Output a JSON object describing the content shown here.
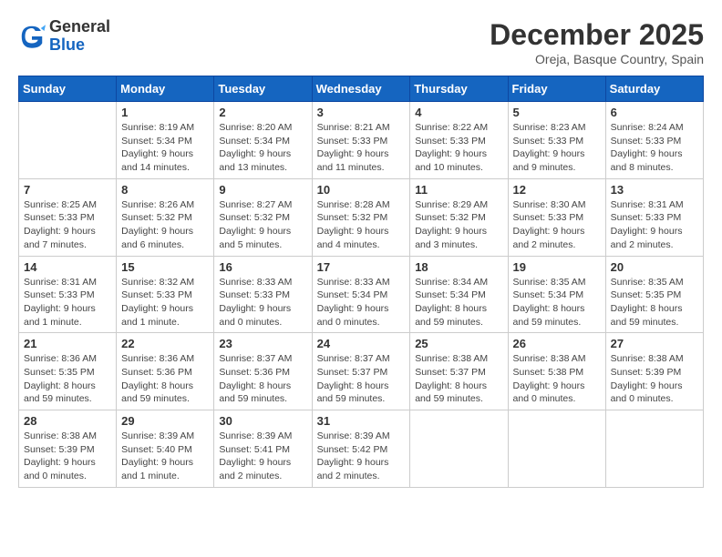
{
  "header": {
    "logo_line1": "General",
    "logo_line2": "Blue",
    "month_title": "December 2025",
    "location": "Oreja, Basque Country, Spain"
  },
  "days_of_week": [
    "Sunday",
    "Monday",
    "Tuesday",
    "Wednesday",
    "Thursday",
    "Friday",
    "Saturday"
  ],
  "weeks": [
    [
      {
        "day": "",
        "info": ""
      },
      {
        "day": "1",
        "info": "Sunrise: 8:19 AM\nSunset: 5:34 PM\nDaylight: 9 hours\nand 14 minutes."
      },
      {
        "day": "2",
        "info": "Sunrise: 8:20 AM\nSunset: 5:34 PM\nDaylight: 9 hours\nand 13 minutes."
      },
      {
        "day": "3",
        "info": "Sunrise: 8:21 AM\nSunset: 5:33 PM\nDaylight: 9 hours\nand 11 minutes."
      },
      {
        "day": "4",
        "info": "Sunrise: 8:22 AM\nSunset: 5:33 PM\nDaylight: 9 hours\nand 10 minutes."
      },
      {
        "day": "5",
        "info": "Sunrise: 8:23 AM\nSunset: 5:33 PM\nDaylight: 9 hours\nand 9 minutes."
      },
      {
        "day": "6",
        "info": "Sunrise: 8:24 AM\nSunset: 5:33 PM\nDaylight: 9 hours\nand 8 minutes."
      }
    ],
    [
      {
        "day": "7",
        "info": "Sunrise: 8:25 AM\nSunset: 5:33 PM\nDaylight: 9 hours\nand 7 minutes."
      },
      {
        "day": "8",
        "info": "Sunrise: 8:26 AM\nSunset: 5:32 PM\nDaylight: 9 hours\nand 6 minutes."
      },
      {
        "day": "9",
        "info": "Sunrise: 8:27 AM\nSunset: 5:32 PM\nDaylight: 9 hours\nand 5 minutes."
      },
      {
        "day": "10",
        "info": "Sunrise: 8:28 AM\nSunset: 5:32 PM\nDaylight: 9 hours\nand 4 minutes."
      },
      {
        "day": "11",
        "info": "Sunrise: 8:29 AM\nSunset: 5:32 PM\nDaylight: 9 hours\nand 3 minutes."
      },
      {
        "day": "12",
        "info": "Sunrise: 8:30 AM\nSunset: 5:33 PM\nDaylight: 9 hours\nand 2 minutes."
      },
      {
        "day": "13",
        "info": "Sunrise: 8:31 AM\nSunset: 5:33 PM\nDaylight: 9 hours\nand 2 minutes."
      }
    ],
    [
      {
        "day": "14",
        "info": "Sunrise: 8:31 AM\nSunset: 5:33 PM\nDaylight: 9 hours\nand 1 minute."
      },
      {
        "day": "15",
        "info": "Sunrise: 8:32 AM\nSunset: 5:33 PM\nDaylight: 9 hours\nand 1 minute."
      },
      {
        "day": "16",
        "info": "Sunrise: 8:33 AM\nSunset: 5:33 PM\nDaylight: 9 hours\nand 0 minutes."
      },
      {
        "day": "17",
        "info": "Sunrise: 8:33 AM\nSunset: 5:34 PM\nDaylight: 9 hours\nand 0 minutes."
      },
      {
        "day": "18",
        "info": "Sunrise: 8:34 AM\nSunset: 5:34 PM\nDaylight: 8 hours\nand 59 minutes."
      },
      {
        "day": "19",
        "info": "Sunrise: 8:35 AM\nSunset: 5:34 PM\nDaylight: 8 hours\nand 59 minutes."
      },
      {
        "day": "20",
        "info": "Sunrise: 8:35 AM\nSunset: 5:35 PM\nDaylight: 8 hours\nand 59 minutes."
      }
    ],
    [
      {
        "day": "21",
        "info": "Sunrise: 8:36 AM\nSunset: 5:35 PM\nDaylight: 8 hours\nand 59 minutes."
      },
      {
        "day": "22",
        "info": "Sunrise: 8:36 AM\nSunset: 5:36 PM\nDaylight: 8 hours\nand 59 minutes."
      },
      {
        "day": "23",
        "info": "Sunrise: 8:37 AM\nSunset: 5:36 PM\nDaylight: 8 hours\nand 59 minutes."
      },
      {
        "day": "24",
        "info": "Sunrise: 8:37 AM\nSunset: 5:37 PM\nDaylight: 8 hours\nand 59 minutes."
      },
      {
        "day": "25",
        "info": "Sunrise: 8:38 AM\nSunset: 5:37 PM\nDaylight: 8 hours\nand 59 minutes."
      },
      {
        "day": "26",
        "info": "Sunrise: 8:38 AM\nSunset: 5:38 PM\nDaylight: 9 hours\nand 0 minutes."
      },
      {
        "day": "27",
        "info": "Sunrise: 8:38 AM\nSunset: 5:39 PM\nDaylight: 9 hours\nand 0 minutes."
      }
    ],
    [
      {
        "day": "28",
        "info": "Sunrise: 8:38 AM\nSunset: 5:39 PM\nDaylight: 9 hours\nand 0 minutes."
      },
      {
        "day": "29",
        "info": "Sunrise: 8:39 AM\nSunset: 5:40 PM\nDaylight: 9 hours\nand 1 minute."
      },
      {
        "day": "30",
        "info": "Sunrise: 8:39 AM\nSunset: 5:41 PM\nDaylight: 9 hours\nand 2 minutes."
      },
      {
        "day": "31",
        "info": "Sunrise: 8:39 AM\nSunset: 5:42 PM\nDaylight: 9 hours\nand 2 minutes."
      },
      {
        "day": "",
        "info": ""
      },
      {
        "day": "",
        "info": ""
      },
      {
        "day": "",
        "info": ""
      }
    ]
  ]
}
